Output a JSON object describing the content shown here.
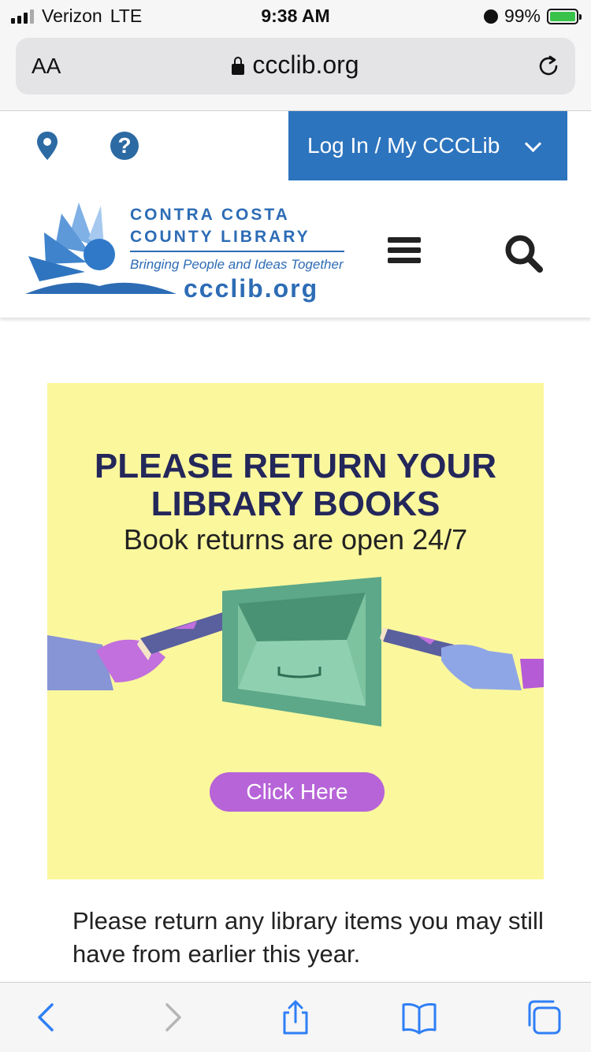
{
  "status_bar": {
    "carrier": "Verizon",
    "network": "LTE",
    "time": "9:38 AM",
    "battery_percent": "99%",
    "battery_level": 0.99,
    "icons": [
      "signal-bars-icon",
      "alarm-icon",
      "battery-charging-icon"
    ]
  },
  "browser": {
    "text_size_label": "AA",
    "url": "ccclib.org",
    "icons": [
      "lock-icon",
      "reload-icon"
    ]
  },
  "site_nav": {
    "login_label": "Log In / My CCCLib",
    "icons": [
      "location-pin-icon",
      "help-icon",
      "chevron-down-icon"
    ]
  },
  "logo": {
    "line1": "CONTRA COSTA",
    "line2": "COUNTY LIBRARY",
    "tagline": "Bringing People and Ideas Together",
    "url": "ccclib.org"
  },
  "header_icons": [
    "hamburger-menu-icon",
    "search-icon"
  ],
  "banner": {
    "headline_line1": "PLEASE RETURN YOUR",
    "headline_line2": "LIBRARY BOOKS",
    "subheadline": "Book returns are open 24/7",
    "button_label": "Click Here"
  },
  "body_text": "Please return any library items you may still have from earlier this year.",
  "bottom_toolbar": {
    "icons": [
      "back-icon",
      "forward-icon",
      "share-icon",
      "bookmarks-icon",
      "tabs-icon"
    ]
  },
  "colors": {
    "brand_blue": "#2d74be",
    "banner_yellow": "#fbf79d",
    "banner_navy": "#23275a",
    "button_purple": "#b764d8",
    "ios_blue": "#2f7ff6"
  }
}
